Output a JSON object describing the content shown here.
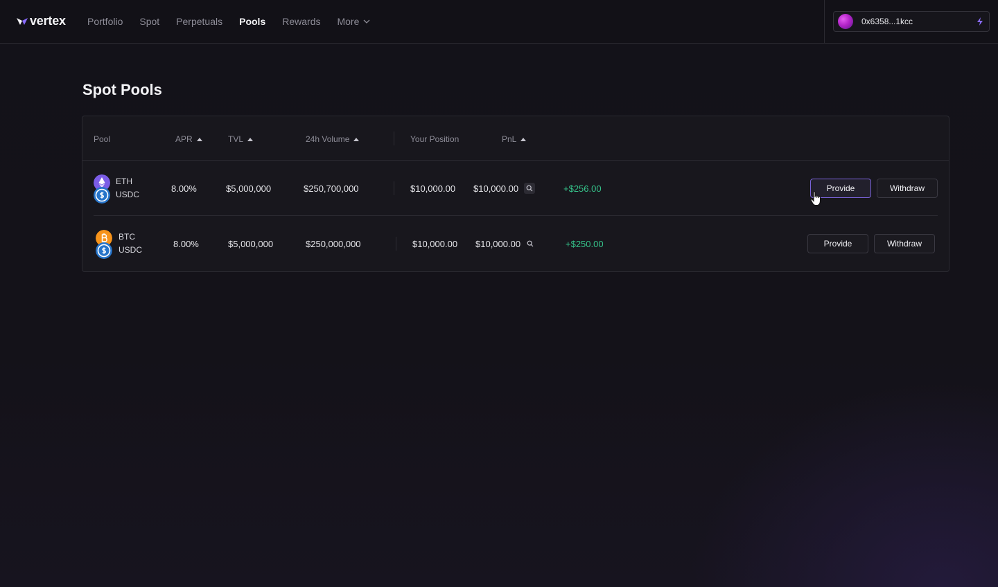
{
  "brand": {
    "name": "vertex",
    "accent": "#8a6cff"
  },
  "nav": {
    "items": [
      {
        "label": "Portfolio",
        "active": false
      },
      {
        "label": "Spot",
        "active": false
      },
      {
        "label": "Perpetuals",
        "active": false
      },
      {
        "label": "Pools",
        "active": true
      },
      {
        "label": "Rewards",
        "active": false
      }
    ],
    "more_label": "More"
  },
  "wallet": {
    "address": "0x6358...1kcc",
    "icon": "bolt-icon"
  },
  "page": {
    "title": "Spot Pools"
  },
  "table": {
    "columns": {
      "pool": "Pool",
      "apr": "APR",
      "tvl": "TVL",
      "volume": "24h Volume",
      "position": "Your Position",
      "pnl": "PnL"
    },
    "rows": [
      {
        "base": "ETH",
        "quote": "USDC",
        "apr": "8.00%",
        "tvl": "$5,000,000",
        "volume": "$250,700,000",
        "position": "$10,000.00",
        "position_value": "$10,000.00",
        "pnl": "+$256.00",
        "provide": "Provide",
        "withdraw": "Withdraw"
      },
      {
        "base": "BTC",
        "quote": "USDC",
        "apr": "8.00%",
        "tvl": "$5,000,000",
        "volume": "$250,000,000",
        "position": "$10,000.00",
        "position_value": "$10,000.00",
        "pnl": "+$250.00",
        "provide": "Provide",
        "withdraw": "Withdraw"
      }
    ]
  },
  "colors": {
    "positive": "#35c38a",
    "eth": "#7b5ce6",
    "btc": "#f7931a",
    "usdc": "#2775ca"
  }
}
